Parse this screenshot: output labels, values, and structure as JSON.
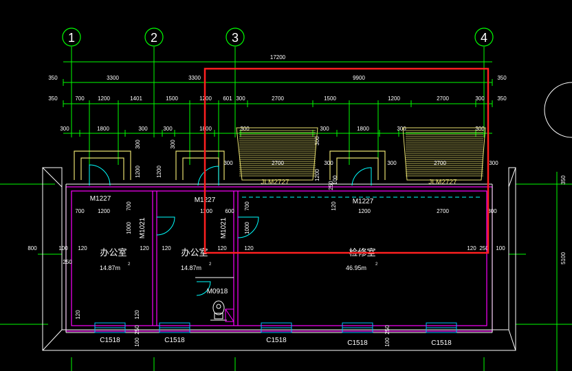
{
  "axes": {
    "a1": "1",
    "a2": "2",
    "a3": "3",
    "a4": "4"
  },
  "dims": {
    "total": "17200",
    "r1_350a": "350",
    "r1_3300a": "3300",
    "r1_3300b": "3300",
    "r1_9900": "9900",
    "r1_350b": "350",
    "r2_350a": "350",
    "r2_700": "700",
    "r2_1200a": "1200",
    "r2_1401": "1401",
    "r2_1500a": "1500",
    "r2_1200b": "1200",
    "r2_601": "601",
    "r2_300": "300",
    "r2_2700a": "2700",
    "r2_1500b": "1500",
    "r2_1200c": "1200",
    "r2_2700b": "2700",
    "r2_300b": "300",
    "r2_350b": "350",
    "r3_300a": "300",
    "r3_1800a": "1800",
    "r3_300b": "300",
    "r3_300c": "300",
    "r3_1800b": "1800",
    "r3_300d": "300",
    "r3_300e": "300",
    "r3_1800c": "1800",
    "r3_300f": "300",
    "r3_300g": "300",
    "v300a": "300",
    "v300b": "300",
    "v300c": "300",
    "v1200a": "1200",
    "v1200b": "1200",
    "v1200c": "1200",
    "i300a": "300",
    "i2700a": "2700",
    "i300b": "300",
    "i300c": "300",
    "i2700b": "2700",
    "i300d": "300",
    "i250": "250",
    "i100": "100",
    "b700a": "700",
    "b1200a": "1200",
    "b700b": "700",
    "b1200b": "1200",
    "b600": "600",
    "b1200c": "1200",
    "b2700": "2700",
    "b300": "300",
    "b120": "120",
    "v700a": "700",
    "v700b": "700",
    "v1000a": "1000",
    "v1000b": "1000",
    "l800": "800",
    "l100": "100",
    "l250": "250",
    "m120a": "120",
    "m120b": "120",
    "m120c": "120",
    "m120d": "120",
    "m120e": "120",
    "m120f": "120",
    "m120g": "120",
    "m250": "250",
    "m100": "100",
    "r350": "350",
    "r5100": "5100",
    "s120": "120",
    "s250a": "250",
    "s100a": "100",
    "s250b": "250",
    "s100b": "100"
  },
  "labels": {
    "m1227a": "M1227",
    "m1227b": "M1227",
    "m1227c": "M1227",
    "m1021a": "M1021",
    "m1021b": "M1021",
    "m0918": "M0918",
    "jlm2727a": "JLM2727",
    "jlm2727b": "JLM2727",
    "c1518a": "C1518",
    "c1518b": "C1518",
    "c1518c": "C1518",
    "c1518d": "C1518",
    "c1518e": "C1518"
  },
  "rooms": {
    "office1_name": "办公室",
    "office1_area": "14.87m",
    "office2_name": "办公室",
    "office2_area": "14.87m",
    "repair_name": "检修室",
    "repair_area": "46.95m",
    "sup": "2"
  },
  "colors": {
    "background": "#000000",
    "dim_line": "#00ff00",
    "wall_outer": "#ffffff",
    "wall_magenta": "#ff00ff",
    "door": "#00ffff",
    "yellow": "#e8e070",
    "selection": "#ff2020",
    "window": "#00bfff"
  }
}
